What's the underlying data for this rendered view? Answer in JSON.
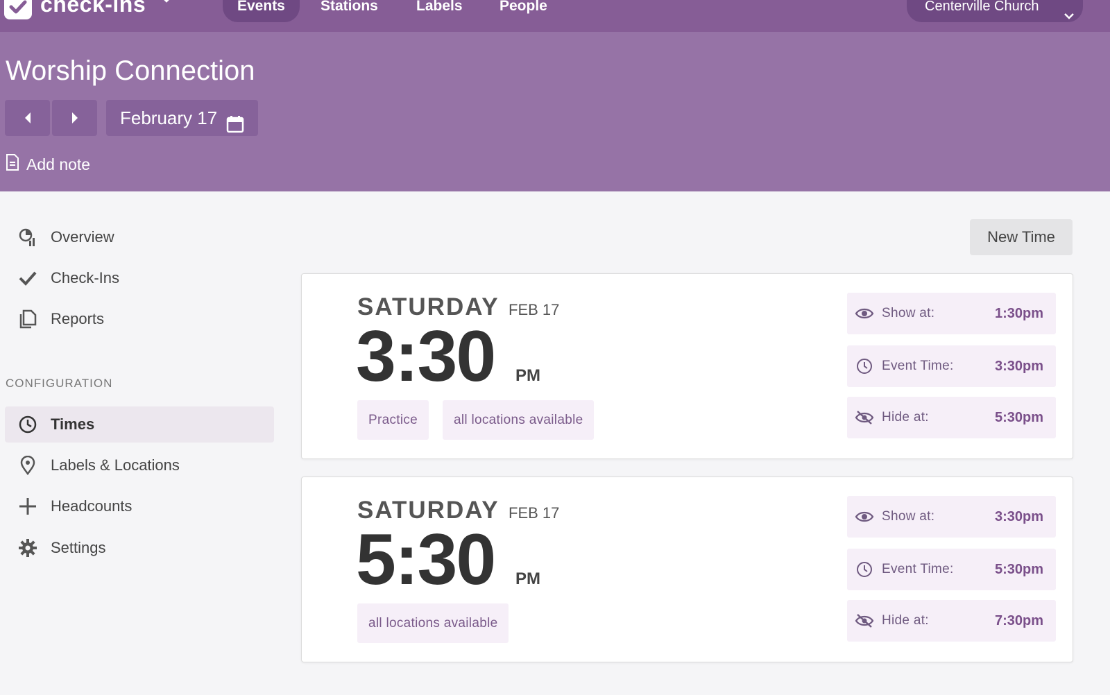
{
  "app": {
    "name": "check-ins",
    "org": "Centerville Church"
  },
  "nav": {
    "tabs": [
      {
        "label": "Events",
        "active": true
      },
      {
        "label": "Stations",
        "active": false
      },
      {
        "label": "Labels",
        "active": false
      },
      {
        "label": "People",
        "active": false
      }
    ]
  },
  "header": {
    "title": "Worship Connection",
    "date": "February 17",
    "add_note": "Add note"
  },
  "sidebar": {
    "items": [
      {
        "label": "Overview",
        "icon": "overview-icon"
      },
      {
        "label": "Check-Ins",
        "icon": "check-icon"
      },
      {
        "label": "Reports",
        "icon": "reports-icon"
      }
    ],
    "config_heading": "CONFIGURATION",
    "config_items": [
      {
        "label": "Times",
        "icon": "clock-icon",
        "active": true
      },
      {
        "label": "Labels & Locations",
        "icon": "location-pin-icon",
        "active": false
      },
      {
        "label": "Headcounts",
        "icon": "plus-icon",
        "active": false
      },
      {
        "label": "Settings",
        "icon": "gear-icon",
        "active": false
      }
    ]
  },
  "main": {
    "new_time": "New Time",
    "times": [
      {
        "day": "SATURDAY",
        "date": "FEB 17",
        "time": "3:30",
        "ampm": "PM",
        "tags": [
          "Practice",
          "all locations available"
        ],
        "show_label": "Show at:",
        "show_at": "1:30pm",
        "event_label": "Event Time:",
        "event_time": "3:30pm",
        "hide_label": "Hide at:",
        "hide_at": "5:30pm"
      },
      {
        "day": "SATURDAY",
        "date": "FEB 17",
        "time": "5:30",
        "ampm": "PM",
        "tags": [
          "all locations available"
        ],
        "show_label": "Show at:",
        "show_at": "3:30pm",
        "event_label": "Event Time:",
        "event_time": "5:30pm",
        "hide_label": "Hide at:",
        "hide_at": "7:30pm"
      }
    ]
  },
  "colors": {
    "brand": "#865d96",
    "header_band": "#9673a6",
    "tag_bg": "#f6eff8",
    "accent_text": "#7a4f8a"
  }
}
